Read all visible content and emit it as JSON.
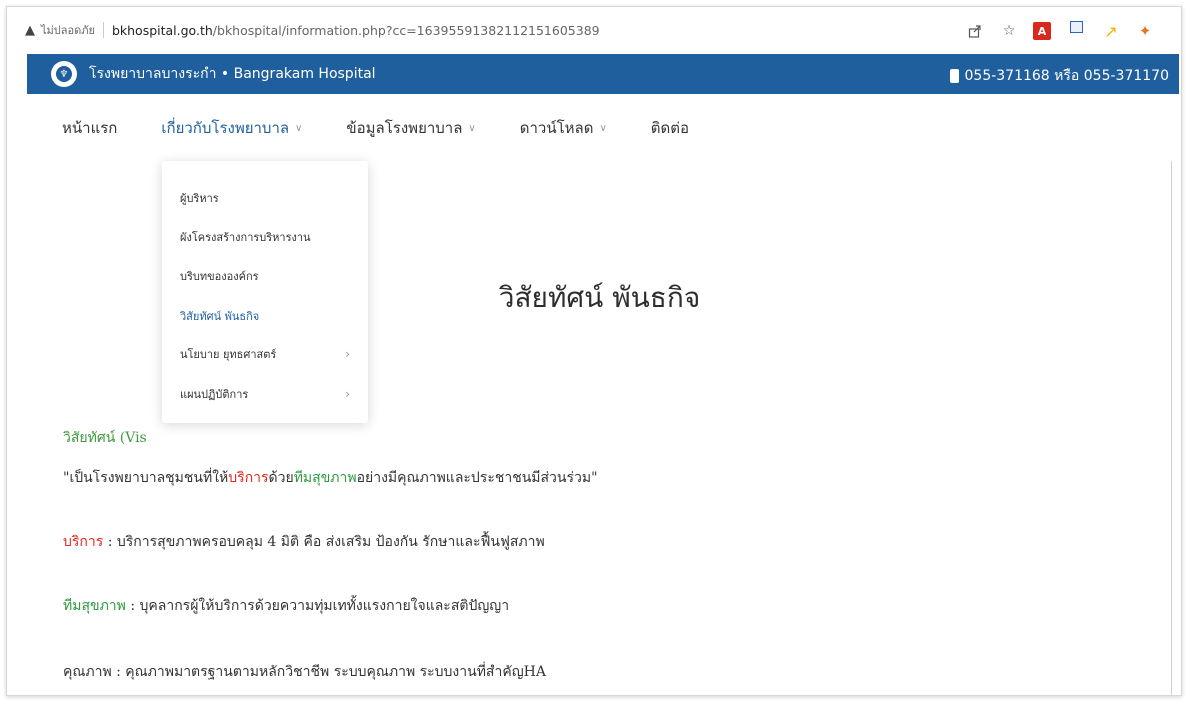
{
  "browser": {
    "security_label": "ไม่ปลอดภัย",
    "url_host": "bkhospital.go.th",
    "url_path": "/bkhospital/information.php?cc=1639559138211215160538​9"
  },
  "site": {
    "title": "โรงพยาบาลบางระกำ • Bangrakam Hospital",
    "phone": "055-371168 หรือ 055-371170"
  },
  "nav": {
    "items": [
      {
        "label": "หน้าแรก"
      },
      {
        "label": "เกี่ยวกับโรงพยาบาล"
      },
      {
        "label": "ข้อมูลโรงพยาบาล"
      },
      {
        "label": "ดาวน์โหลด"
      },
      {
        "label": "ติดต่อ"
      }
    ]
  },
  "dropdown": {
    "items": [
      {
        "label": "ผู้บริหาร"
      },
      {
        "label": "ผังโครงสร้างการบริหารงาน"
      },
      {
        "label": "บริบทขององค์กร"
      },
      {
        "label": "วิสัยทัศน์ พันธกิจ"
      },
      {
        "label": "นโยบาย ยุทธศาสตร์"
      },
      {
        "label": "แผนปฏิบัติการ"
      }
    ]
  },
  "content": {
    "heading": "วิสัยทัศน์ พันธกิจ",
    "vision_label": "วิสัยทัศน์ (Vis",
    "quote_1": "\"เป็นโรงพยาบาลชุมชนที่ให้",
    "quote_2": "บริการ",
    "quote_3": "ด้วย",
    "quote_4": "ทีมสุขภาพ",
    "quote_5": "อย่างมีคุณภาพและประชาชนมีส่วนร่วม\"",
    "service_term": "บริการ",
    "service_desc": " : บริการสุขภาพครอบคลุม 4 มิติ คือ ส่งเสริม ป้องกัน รักษาและฟื้นฟูสภาพ",
    "team_term": "ทีมสุขภาพ",
    "team_desc": " : บุคลากรผู้ให้บริการด้วยความทุ่มเททั้งแรงกายใจและสติปัญญา",
    "quality_text": "คุณภาพ : คุณภาพมาตรฐานตามหลักวิชาชีพ ระบบคุณภาพ  ระบบงานที่สำคัญHA"
  }
}
